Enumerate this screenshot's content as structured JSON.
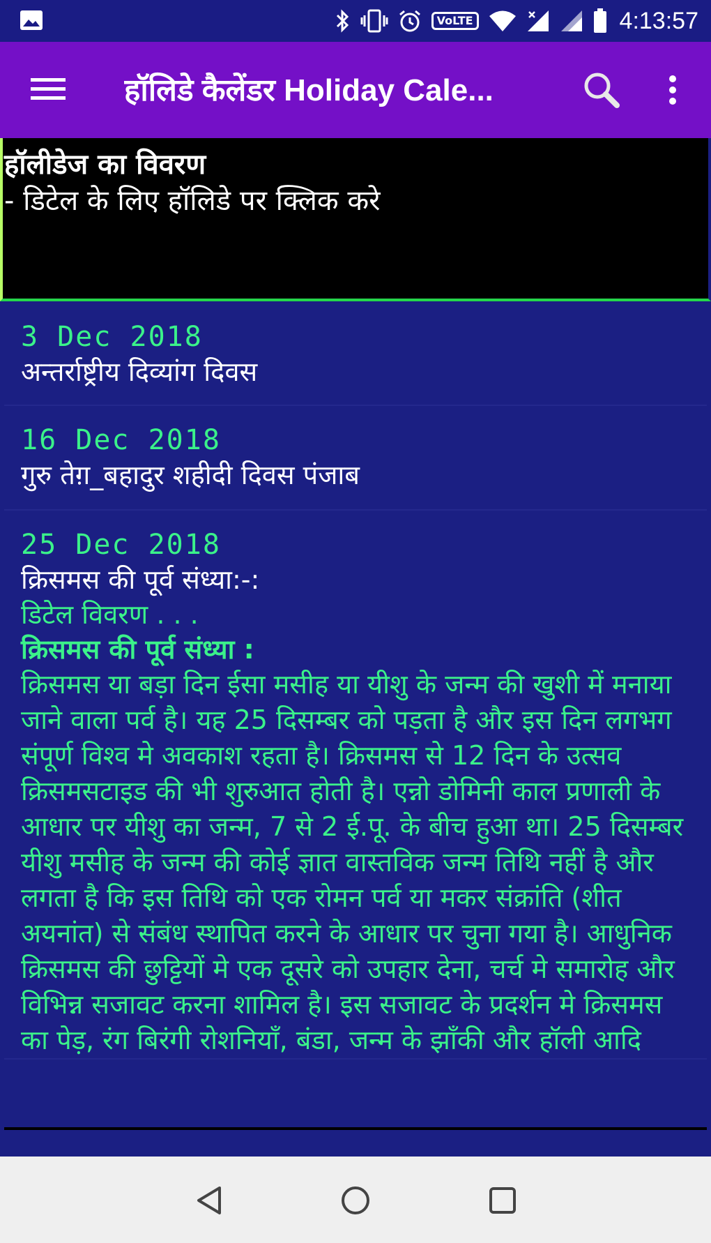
{
  "status_bar": {
    "time": "4:13:57",
    "volte": "VoLTE",
    "icons": [
      "image-icon",
      "bluetooth-icon",
      "vibrate-icon",
      "alarm-icon",
      "volte-icon",
      "wifi-icon",
      "signal-icon",
      "signal-icon",
      "battery-icon"
    ]
  },
  "app_bar": {
    "title": "हॉलिडे कैलेंडर Holiday Cale...",
    "background": "#7410c7",
    "icons": [
      "menu-icon",
      "search-icon",
      "more-vert-icon"
    ]
  },
  "info_panel": {
    "title": "हॉलीडेज का विवरण",
    "subtitle": "- डिटेल के लिए हॉलिडे पर क्लिक करे"
  },
  "holidays": [
    {
      "date": "3 Dec 2018",
      "name": "अन्तर्राष्ट्रीय दिव्यांग दिवस"
    },
    {
      "date": "16 Dec 2018",
      "name": "गुरु तेग़_बहादुर शहीदी दिवस पंजाब"
    },
    {
      "date": "25 Dec 2018",
      "name": "क्रिसमस की पूर्व संध्या:-:",
      "detail_link": "डिटेल विवरण . . .",
      "detail_heading": "क्रिसमस की पूर्व संध्या :",
      "detail_body": "क्रिसमस या बड़ा दिन ईसा मसीह या यीशु के जन्म की खुशी में मनाया जाने वाला पर्व है। यह 25 दिसम्बर को पड़ता है और इस दिन लगभग संपूर्ण विश्व मे अवकाश रहता है। क्रिसमस से 12 दिन के उत्सव क्रिसमसटाइड की भी शुरुआत होती है। एन्नो डोमिनी काल प्रणाली के आधार पर यीशु का जन्म, 7 से 2 ई.पू. के बीच हुआ था। 25 दिसम्बर यीशु मसीह के जन्म की कोई ज्ञात वास्तविक जन्म तिथि नहीं है और लगता है कि इस तिथि को एक रोमन पर्व या मकर संक्रांति (शीत अयनांत) से संबंध स्थापित करने के आधार पर चुना गया है। आधुनिक क्रिसमस की छुट्टियों मे एक दूसरे को उपहार देना, चर्च मे समारोह और विभिन्न सजावट करना शामिल है। इस सजावट के प्रदर्शन मे क्रिसमस का पेड़, रंग बिरंगी रोशनियाँ, बंडा, जन्म के झाँकी और हॉली आदि"
    }
  ],
  "colors": {
    "list_background": "#1b1f83",
    "date_text": "#3bf28a",
    "panel_background": "#000000"
  },
  "nav_bar": {
    "icons": [
      "back-icon",
      "home-icon",
      "recents-icon"
    ]
  }
}
